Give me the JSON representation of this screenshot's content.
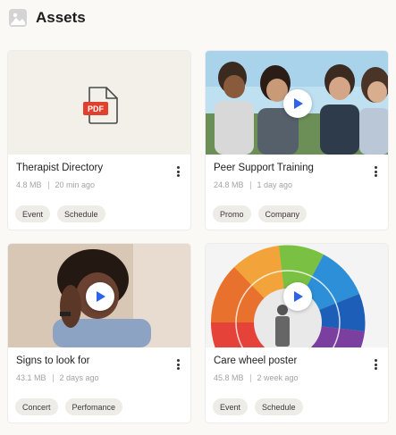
{
  "header": {
    "title": "Assets",
    "icon": "image-icon"
  },
  "cards": [
    {
      "title": "Therapist Directory",
      "size": "4.8 MB",
      "time": "20 min ago",
      "tags": [
        "Event",
        "Schedule"
      ],
      "kind": "pdf",
      "file_badge": "PDF"
    },
    {
      "title": "Peer Support Training",
      "size": "24.8 MB",
      "time": "1 day ago",
      "tags": [
        "Promo",
        "Company"
      ],
      "kind": "video"
    },
    {
      "title": "Signs to look for",
      "size": "43.1 MB",
      "time": "2 days ago",
      "tags": [
        "Concert",
        "Perfomance"
      ],
      "kind": "video"
    },
    {
      "title": "Care wheel  poster",
      "size": "45.8 MB",
      "time": "2 week ago",
      "tags": [
        "Event",
        "Schedule"
      ],
      "kind": "video"
    }
  ],
  "colors": {
    "accent": "#2d63e6",
    "pdf_red": "#e0402d",
    "tag_bg": "#eeece7",
    "page_bg": "#faf9f6"
  }
}
